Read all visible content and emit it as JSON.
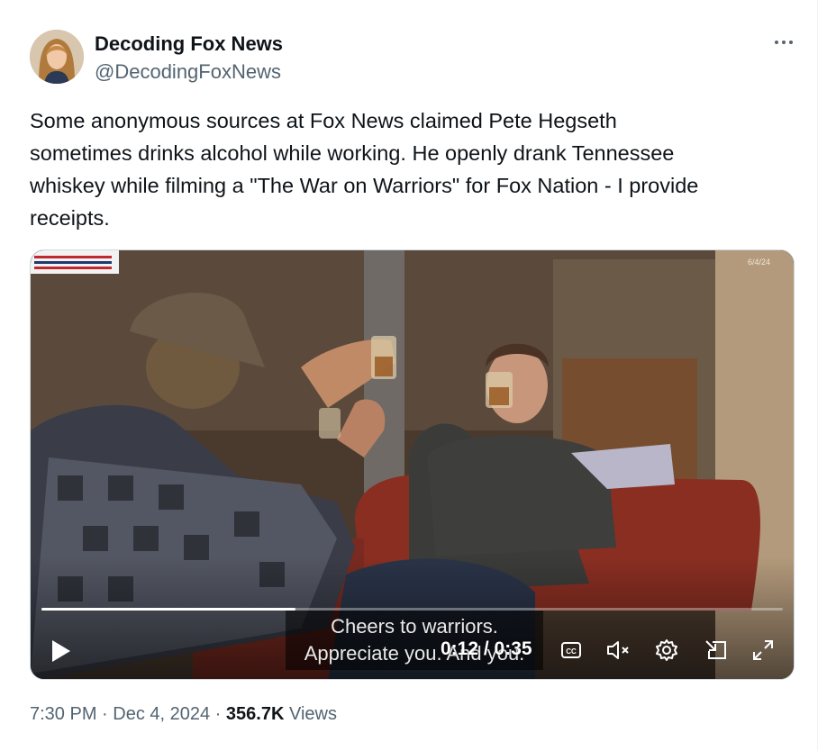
{
  "author": {
    "name": "Decoding Fox News",
    "handle": "@DecodingFoxNews"
  },
  "tweet": {
    "text_lines": [
      "Some anonymous sources at Fox News claimed Pete Hegseth",
      "sometimes drinks alcohol while working.  He openly drank Tennessee",
      "whiskey while filming a \"The War on Warriors\" for Fox Nation - I provide",
      "receipts."
    ]
  },
  "video": {
    "date_stamp": "6/4/24",
    "caption_line1": "Cheers to warriors.",
    "caption_line2": "Appreciate you. And you.",
    "elapsed": "0:12",
    "separator": " / ",
    "duration": "0:35",
    "progress": 0.343,
    "controls": {
      "play": "play-icon",
      "captions": "cc-icon",
      "mute": "muted-speaker-icon",
      "settings": "gear-icon",
      "pip": "picture-in-picture-icon",
      "fullscreen": "expand-icon"
    }
  },
  "meta": {
    "time": "7:30 PM",
    "dot1": " · ",
    "date": "Dec 4, 2024",
    "dot2": " · ",
    "views_count": "356.7K",
    "views_label": " Views"
  },
  "colors": {
    "text": "#0f1419",
    "secondary": "#536471",
    "border": "#cfd9de"
  }
}
